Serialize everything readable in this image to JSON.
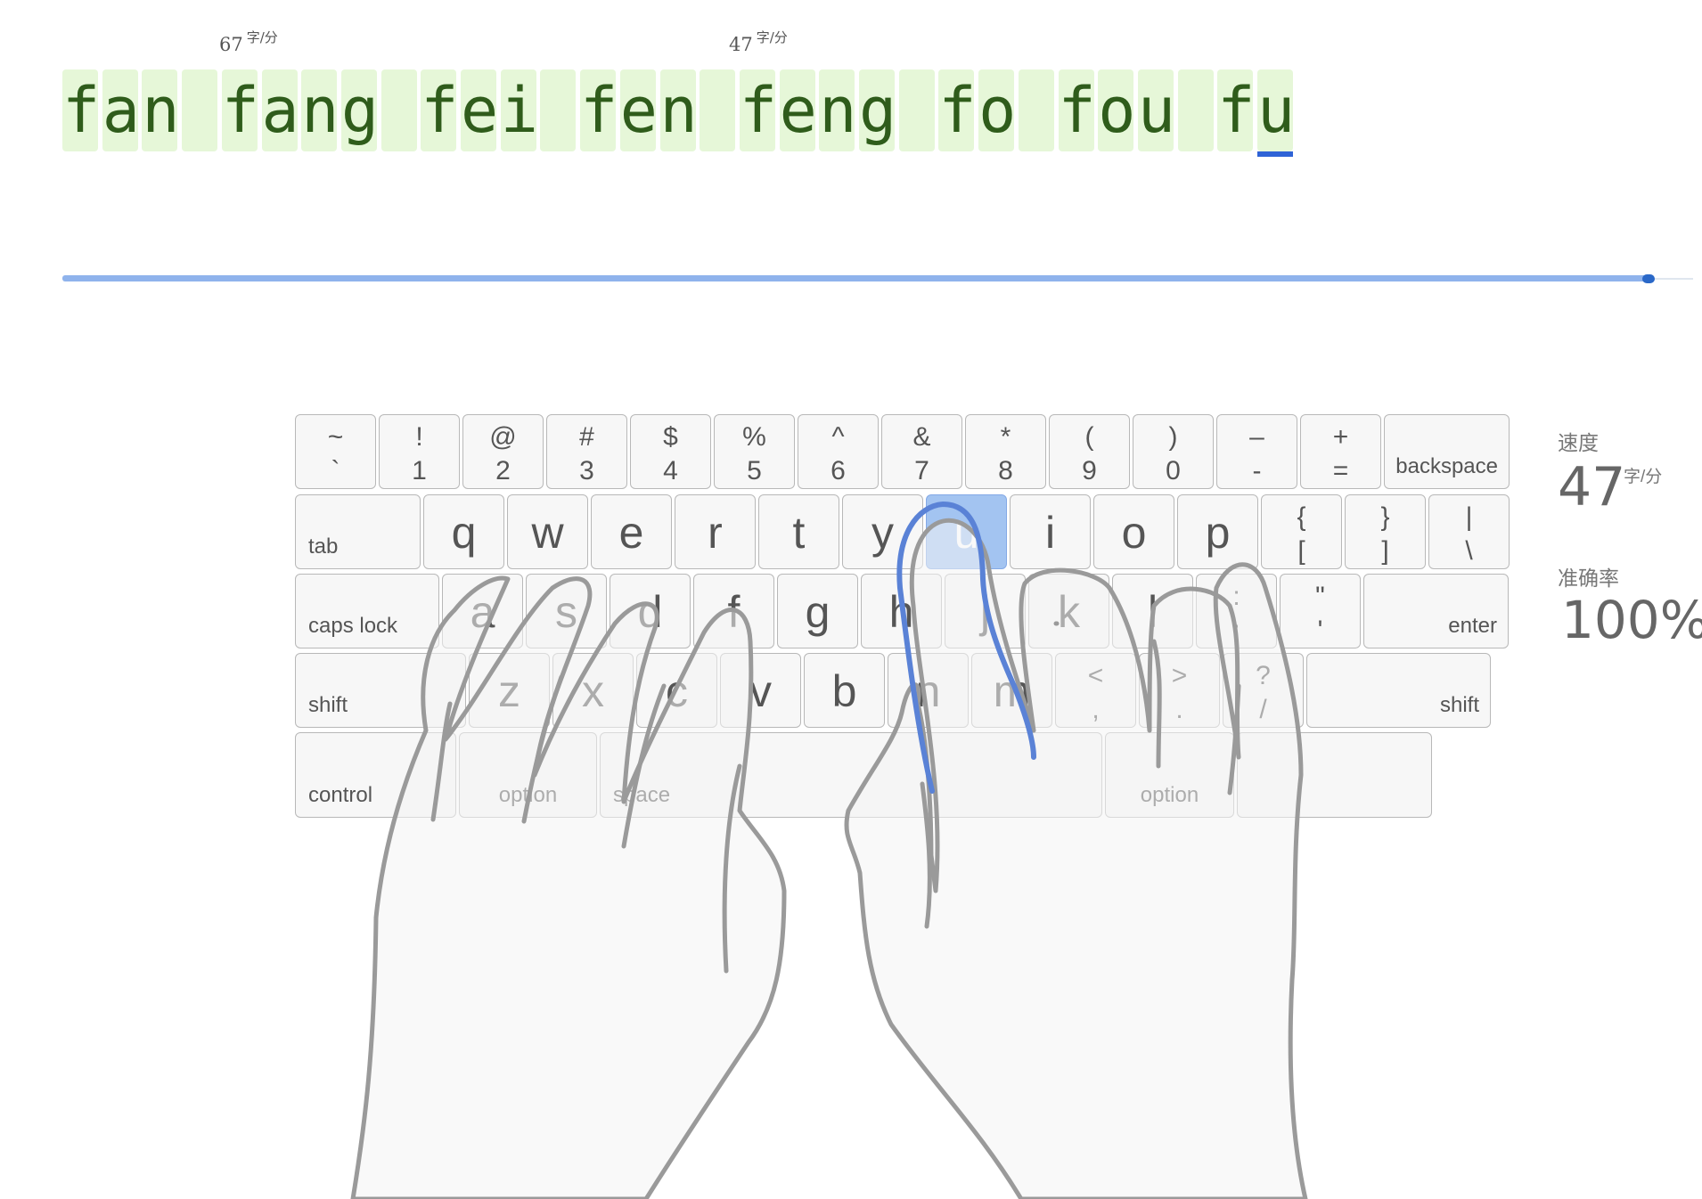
{
  "typing": {
    "text": "fan fang fei fen feng fo fou fu",
    "cursor_index": 30,
    "word_speeds": [
      {
        "value": "67",
        "unit": "字/分"
      },
      {
        "value": "47",
        "unit": "字/分"
      }
    ]
  },
  "progress": {
    "fraction": 0.99
  },
  "stats": {
    "speed_label": "速度",
    "speed_value": "47",
    "speed_unit": "字/分",
    "accuracy_label": "准确率",
    "accuracy_value": "100%"
  },
  "keyboard": {
    "active_key": "u",
    "rows": [
      [
        {
          "top": "~",
          "bottom": "`"
        },
        {
          "top": "!",
          "bottom": "1"
        },
        {
          "top": "@",
          "bottom": "2"
        },
        {
          "top": "#",
          "bottom": "3"
        },
        {
          "top": "$",
          "bottom": "4"
        },
        {
          "top": "%",
          "bottom": "5"
        },
        {
          "top": "^",
          "bottom": "6"
        },
        {
          "top": "&",
          "bottom": "7"
        },
        {
          "top": "*",
          "bottom": "8"
        },
        {
          "top": "(",
          "bottom": "9"
        },
        {
          "top": ")",
          "bottom": "0"
        },
        {
          "top": "–",
          "bottom": "-"
        },
        {
          "top": "+",
          "bottom": "="
        },
        {
          "word": "backspace",
          "align": "r"
        }
      ],
      [
        {
          "word": "tab",
          "align": "l"
        },
        {
          "main": "q"
        },
        {
          "main": "w"
        },
        {
          "main": "e"
        },
        {
          "main": "r"
        },
        {
          "main": "t"
        },
        {
          "main": "y"
        },
        {
          "main": "u"
        },
        {
          "main": "i"
        },
        {
          "main": "o"
        },
        {
          "main": "p"
        },
        {
          "top": "{",
          "bottom": "["
        },
        {
          "top": "}",
          "bottom": "]"
        },
        {
          "top": "|",
          "bottom": "\\"
        }
      ],
      [
        {
          "word": "caps lock",
          "align": "l"
        },
        {
          "main": "a"
        },
        {
          "main": "s"
        },
        {
          "main": "d"
        },
        {
          "main": "f"
        },
        {
          "main": "g"
        },
        {
          "main": "h"
        },
        {
          "main": "j"
        },
        {
          "main": "k"
        },
        {
          "main": "l"
        },
        {
          "top": ":",
          "bottom": ";"
        },
        {
          "top": "\"",
          "bottom": "'"
        },
        {
          "word": "enter",
          "align": "r"
        }
      ],
      [
        {
          "word": "shift",
          "align": "l"
        },
        {
          "main": "z"
        },
        {
          "main": "x"
        },
        {
          "main": "c"
        },
        {
          "main": "v"
        },
        {
          "main": "b"
        },
        {
          "main": "n"
        },
        {
          "main": "m"
        },
        {
          "top": "<",
          "bottom": ","
        },
        {
          "top": ">",
          "bottom": "."
        },
        {
          "top": "?",
          "bottom": "/"
        },
        {
          "word": "shift",
          "align": "r"
        }
      ],
      [
        {
          "word": "control",
          "align": "l"
        },
        {
          "word": "option",
          "align": "c"
        },
        {
          "word": "space",
          "align": "l"
        },
        {
          "word": "",
          "align": "c"
        },
        {
          "word": "option",
          "align": "c"
        },
        {
          "word": "",
          "align": "c"
        }
      ]
    ]
  },
  "colors": {
    "typed_text": "#2f5c1b",
    "char_bg": "#e6f7d8",
    "active_key": "#a3c4f1",
    "cursor": "#2f63d6",
    "active_finger": "#5a82d6",
    "hand_outline": "#9a9a9a"
  },
  "icons": [
    "left-hand-icon",
    "right-hand-icon",
    "active-finger-icon"
  ]
}
